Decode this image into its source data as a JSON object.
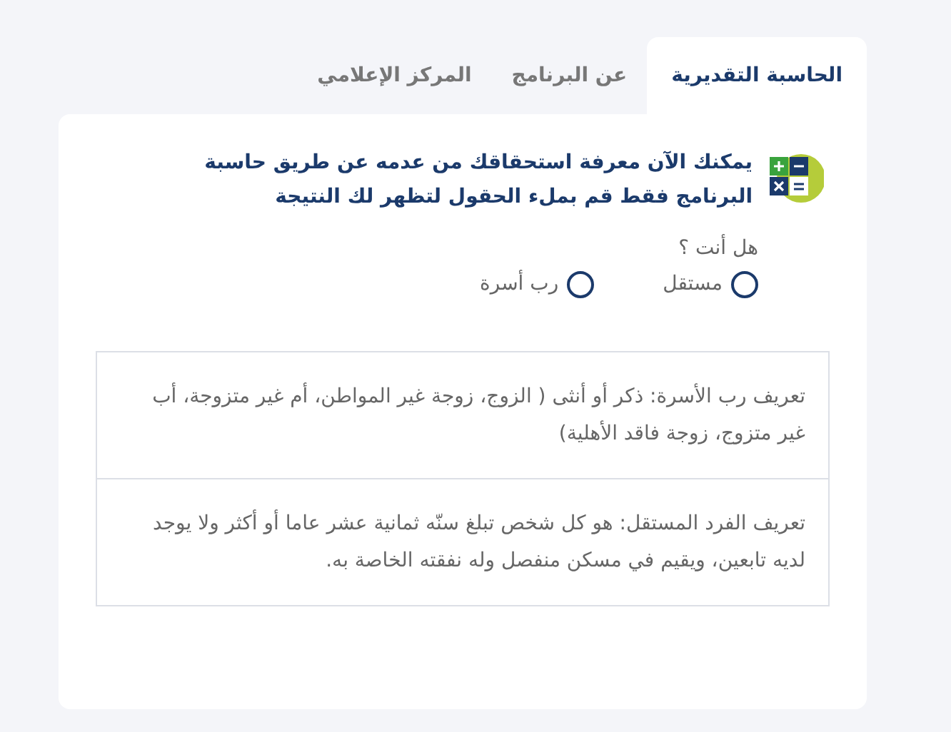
{
  "tabs": [
    {
      "label": "الحاسبة التقديرية",
      "selected": true
    },
    {
      "label": "عن البرنامج",
      "selected": false
    },
    {
      "label": "المركز الإعلامي",
      "selected": false
    }
  ],
  "intro": "يمكنك الآن معرفة استحقاقك من عدمه عن طريق حاسبة البرنامج فقط قم بملء الحقول لتظهر لك النتيجة",
  "question": {
    "label": "هل أنت ؟",
    "options": [
      {
        "label": "مستقل",
        "selected": false
      },
      {
        "label": "رب أسرة",
        "selected": false
      }
    ]
  },
  "definitions": [
    "تعريف رب الأسرة: ذكر أو أنثى ( الزوج، زوجة غير المواطن، أم غير متزوجة، أب غير متزوج، زوجة فاقد الأهلية)",
    "تعريف الفرد المستقل: هو كل شخص تبلغ سنّه ثمانية عشر عاما أو أكثر ولا يوجد لديه تابعين، ويقيم في مسكن منفصل وله نفقته الخاصة به."
  ]
}
